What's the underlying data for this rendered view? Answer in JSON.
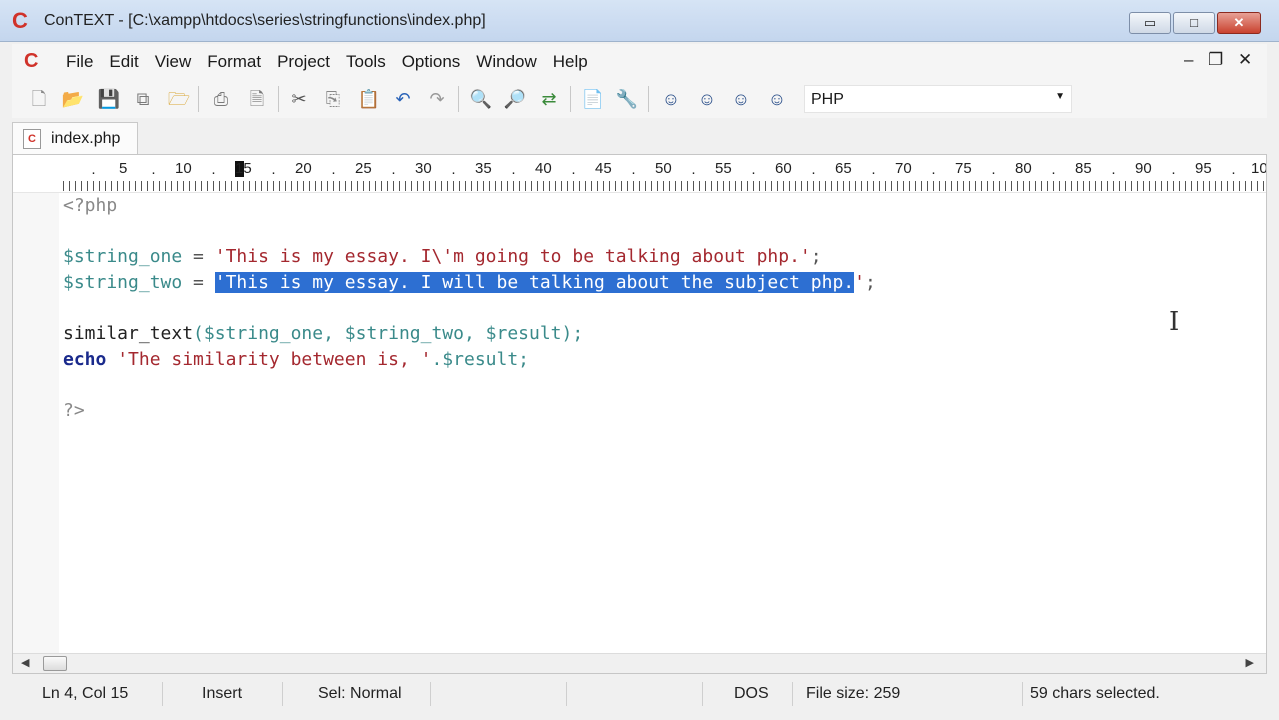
{
  "window": {
    "title": "ConTEXT - [C:\\xampp\\htdocs\\series\\stringfunctions\\index.php]",
    "app_glyph": "C",
    "minimize": "▭",
    "maximize": "□",
    "close": "✕"
  },
  "menu": {
    "items": [
      "File",
      "Edit",
      "View",
      "Format",
      "Project",
      "Tools",
      "Options",
      "Window",
      "Help"
    ],
    "mdi_minimize": "–",
    "mdi_restore": "❐",
    "mdi_close": "✕"
  },
  "toolbar": {
    "language": "PHP"
  },
  "tabs": [
    {
      "label": "index.php",
      "icon": "C"
    }
  ],
  "ruler": {
    "marks": [
      "5",
      "10",
      "15",
      "20",
      "25",
      "30",
      "35",
      "40",
      "45",
      "50",
      "55",
      "60",
      "65",
      "70",
      "75",
      "80",
      "85",
      "90",
      "95",
      "10"
    ]
  },
  "code": {
    "line1": "<?php",
    "line3_var": "$string_one",
    "line3_op": " = ",
    "line3_str": "'This is my essay. I\\'m going to be talking about php.'",
    "line3_end": ";",
    "line4_var": "$string_two",
    "line4_op": " = ",
    "line4_sel": "'This is my essay. I will be talking about the subject php.",
    "line4_str_end": "'",
    "line4_end": ";",
    "line6_fn": "similar_text",
    "line6_args": "($string_one, $string_two, $result);",
    "line7_kw": "echo",
    "line7_str": " 'The similarity between is, '",
    "line7_rest": ".$result;",
    "line9": "?>"
  },
  "status": {
    "position": "Ln 4, Col 15",
    "mode": "Insert",
    "selection_mode": "Sel: Normal",
    "line_ending": "DOS",
    "file_size": "File size: 259",
    "selected": "59 chars selected."
  }
}
